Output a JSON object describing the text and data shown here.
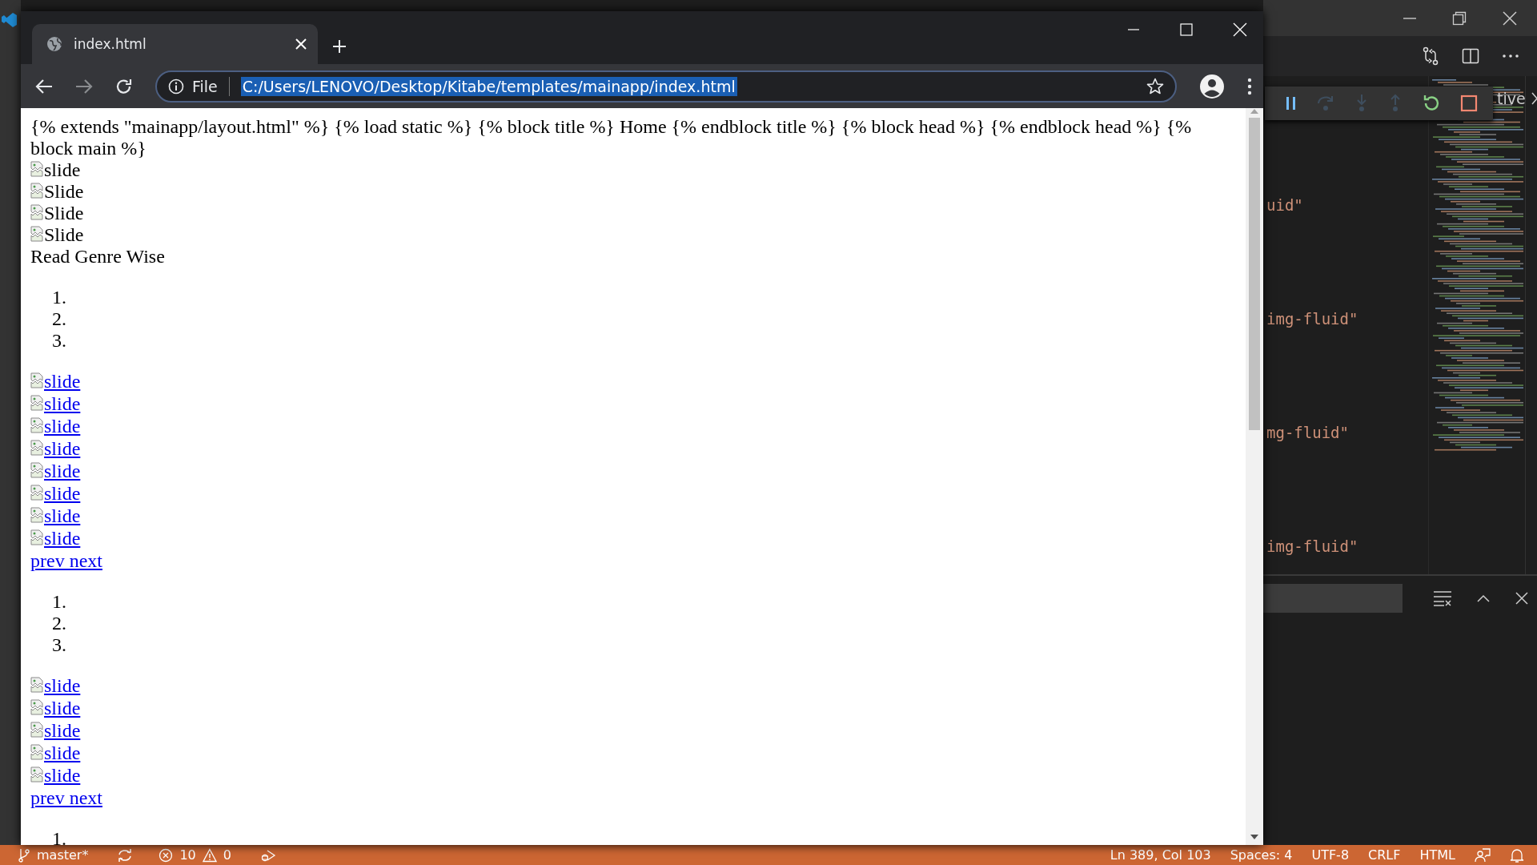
{
  "vscode": {
    "debug_tab": "tive",
    "code_lines": [
      "uid\"",
      "img-fluid\"",
      "mg-fluid\"",
      "img-fluid\""
    ]
  },
  "browser": {
    "tab": {
      "title": "index.html"
    },
    "address": {
      "scheme": "File",
      "url": "C:/Users/LENOVO/Desktop/Kitabe/templates/mainapp/index.html",
      "selected": true
    },
    "page": [
      {
        "kind": "text",
        "text": "{% extends \"mainapp/layout.html\" %} {% load static %} {% block title %} Home {% endblock title %} {% block head %} {% endblock head %} {% block main %}"
      },
      {
        "kind": "image",
        "alt": "slide"
      },
      {
        "kind": "image",
        "alt": "Slide"
      },
      {
        "kind": "image",
        "alt": "Slide"
      },
      {
        "kind": "image",
        "alt": "Slide"
      },
      {
        "kind": "text",
        "text": "Read Genre Wise"
      },
      {
        "kind": "list",
        "markers": [
          "1.",
          "2.",
          "3."
        ]
      },
      {
        "kind": "image-link",
        "alt": "slide"
      },
      {
        "kind": "image-link",
        "alt": "slide"
      },
      {
        "kind": "image-link",
        "alt": "slide"
      },
      {
        "kind": "image-link",
        "alt": "slide"
      },
      {
        "kind": "image-link",
        "alt": "slide"
      },
      {
        "kind": "image-link",
        "alt": "slide"
      },
      {
        "kind": "image-link",
        "alt": "slide"
      },
      {
        "kind": "image-link",
        "alt": "slide"
      },
      {
        "kind": "link",
        "text": "prev next"
      },
      {
        "kind": "list",
        "markers": [
          "1.",
          "2.",
          "3."
        ]
      },
      {
        "kind": "image-link",
        "alt": "slide"
      },
      {
        "kind": "image-link",
        "alt": "slide"
      },
      {
        "kind": "image-link",
        "alt": "slide"
      },
      {
        "kind": "image-link",
        "alt": "slide"
      },
      {
        "kind": "image-link",
        "alt": "slide"
      },
      {
        "kind": "link",
        "text": "prev next"
      },
      {
        "kind": "list",
        "markers": [
          "1."
        ]
      }
    ]
  },
  "status_bar": {
    "branch": "master*",
    "errors": "10",
    "warnings": "0",
    "position": "Ln 389, Col 103",
    "spaces": "Spaces: 4",
    "encoding": "UTF-8",
    "eol": "CRLF",
    "language": "HTML"
  }
}
